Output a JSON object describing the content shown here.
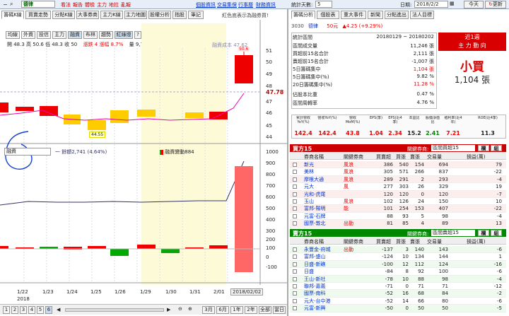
{
  "topbar": {
    "stock_code": "德律",
    "menu": [
      "看法",
      "報告",
      "體檢",
      "主力",
      "地拉",
      "亂報"
    ],
    "links": [
      "個股資訊",
      "交易集保",
      "行事曆",
      "財務資訊"
    ],
    "stat_days_label": "統計天數:",
    "stat_days": "5",
    "date_label": "日期:",
    "date": "2018/2/2",
    "today": "今天",
    "update": "更新"
  },
  "left_tabs": [
    "籌碼K線",
    "買賣走勢",
    "分點K線",
    "大事券商",
    "主力K線",
    "主力地圖",
    "股權分析",
    "指股",
    "筆記"
  ],
  "left_note": "紅色底表示為融券買!",
  "toolbar": {
    "buttons": [
      "均線",
      "外資",
      "投信",
      "主力",
      "融資",
      "布林",
      "趨勢",
      "紅綠燈",
      "?",
      "設"
    ],
    "ohlc": "開 48.3  高 50.6  低 48.3  收 50",
    "change": "漲跌 4  漲幅 8.7%",
    "volume": "量 9,759",
    "avg_label": "融資成本 47.62"
  },
  "price_axis": [
    "51",
    "50",
    "49",
    "48",
    "47",
    "46",
    "45",
    "44"
  ],
  "price_marker": "47.78",
  "low_label": "44.55",
  "high_label": "50.6",
  "sub_panel": {
    "selector": "融資",
    "legend1": "一 餘額2,741 (4.64%)",
    "legend2": "融資變動884"
  },
  "sub_axis": [
    "1000",
    "900",
    "800",
    "700",
    "600",
    "500",
    "400",
    "300",
    "200",
    "100",
    "0",
    "-100"
  ],
  "dates": [
    "1/22",
    "1/23",
    "1/24",
    "1/25",
    "1/26",
    "1/29",
    "1/30",
    "1/31",
    "2/01",
    "2018/02/02"
  ],
  "year": "2018",
  "bottom": {
    "pages": [
      "1",
      "2",
      "3",
      "4",
      "5",
      "6"
    ],
    "ranges": [
      "3月",
      "6月",
      "1年",
      "2年",
      "全部",
      "當日"
    ]
  },
  "right_tabs": [
    "籌碼分析",
    "個股表",
    "重大事件",
    "新聞",
    "分點進出",
    "法人目標"
  ],
  "summary": {
    "code": "3030",
    "name": "德律",
    "price": "50元",
    "change": "▲4.25 (+9.29%)",
    "rows": [
      {
        "label": "統計區間",
        "value": "20180129 ~ 20180202"
      },
      {
        "label": "區間成交量",
        "value": "11,246 張"
      },
      {
        "label": "買超前15名合計",
        "value": "2,111 張"
      },
      {
        "label": "賣超前15名合計",
        "value": "-1,007 張"
      },
      {
        "label": "5日籌碼集中",
        "value": "1,104 張"
      },
      {
        "label": "5日籌碼集中(%)",
        "value": "9.82 %"
      },
      {
        "label": "20日籌碼集中(%)",
        "value": "11.28 %"
      },
      {
        "label": "佔股本比重",
        "value": "0.47 %"
      },
      {
        "label": "區間周轉率",
        "value": "4.76 %"
      }
    ],
    "trend_title": "近1週",
    "trend_sub": "主 力 動 向",
    "verdict": "小買",
    "verdict_qty": "1,104 張"
  },
  "stats": {
    "headers": [
      "累計營收YoY(%)",
      "營收YoY(%)",
      "營收MoM(%)",
      "EPS(季)",
      "EPS(近4季)",
      "本益比",
      "股價淨值比",
      "殖利率(近4年)",
      "ROE(近4季)"
    ],
    "values": [
      "142.4",
      "142.4",
      "43.8",
      "1.04",
      "2.34",
      "15.2",
      "2.41",
      "7.21",
      "11.3"
    ]
  },
  "buyers": {
    "title": "買方15",
    "filter_label": "關鍵券商:",
    "filter": "區間買超15",
    "b1": "欄",
    "b2": "組",
    "cols": [
      "",
      "券商名稱",
      "關鍵券商",
      "買賣超",
      "買張",
      "賣張",
      "交易量",
      "損益(萬)"
    ],
    "rows": [
      [
        "新光",
        "風浪",
        "386",
        "540",
        "154",
        "694",
        "79"
      ],
      [
        "美林",
        "風浪",
        "305",
        "571",
        "266",
        "837",
        "-22"
      ],
      [
        "摩根大通",
        "風浪",
        "289",
        "291",
        "2",
        "293",
        "-4"
      ],
      [
        "元大",
        "風",
        "277",
        "303",
        "26",
        "329",
        "19"
      ],
      [
        "光和-虎尾",
        "",
        "120",
        "120",
        "0",
        "120",
        "-7"
      ],
      [
        "玉山",
        "風浪",
        "102",
        "126",
        "24",
        "150",
        "10"
      ],
      [
        "富邦-陽明",
        "能",
        "101",
        "254",
        "153",
        "407",
        "-22"
      ],
      [
        "元富-石牌",
        "",
        "88",
        "93",
        "5",
        "98",
        "-4"
      ],
      [
        "國票-敦北",
        "出動",
        "81",
        "85",
        "4",
        "89",
        "13"
      ]
    ]
  },
  "sellers": {
    "title": "賣方15",
    "filter_label": "關鍵券商:",
    "filter": "區間賣超15",
    "b1": "欄",
    "b2": "組",
    "cols": [
      "",
      "券商名稱",
      "關鍵券商",
      "買賣超",
      "買張",
      "賣張",
      "交易量",
      "損益(萬)"
    ],
    "rows": [
      [
        "永豐金-府城",
        "出動",
        "-137",
        "3",
        "140",
        "143",
        "-6"
      ],
      [
        "富邦-盛山",
        "",
        "-124",
        "10",
        "134",
        "144",
        "1"
      ],
      [
        "日盛-新礁",
        "",
        "-100",
        "12",
        "112",
        "124",
        "-16"
      ],
      [
        "日盛",
        "",
        "-84",
        "8",
        "92",
        "100",
        "-6"
      ],
      [
        "王山-新社",
        "",
        "-78",
        "10",
        "88",
        "98",
        "-4"
      ],
      [
        "聯邦-嘉義",
        "",
        "-71",
        "0",
        "71",
        "71",
        "-12"
      ],
      [
        "國票-南科",
        "",
        "-52",
        "16",
        "68",
        "84",
        "-2"
      ],
      [
        "元大-台中港",
        "",
        "-52",
        "14",
        "66",
        "80",
        "-6"
      ],
      [
        "元富-新興",
        "",
        "-50",
        "0",
        "50",
        "50",
        "-5"
      ]
    ]
  }
}
